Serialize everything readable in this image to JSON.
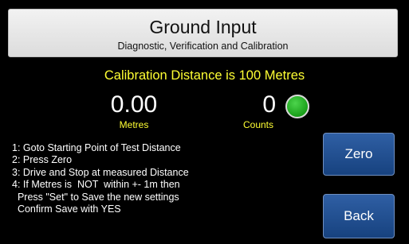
{
  "header": {
    "title": "Ground Input",
    "subtitle": "Diagnostic, Verification and Calibration"
  },
  "calibration": {
    "banner": "Calibration Distance is 100 Metres"
  },
  "readouts": {
    "distance_value": "0.00",
    "distance_unit": "Metres",
    "counts_value": "0",
    "counts_unit": "Counts",
    "status_color": "#1aa01a"
  },
  "instructions": [
    "1: Goto Starting Point of Test Distance",
    "2: Press Zero",
    "3: Drive and Stop at measured Distance",
    "4: If Metres is  NOT  within +- 1m then",
    "  Press \"Set\" to Save the new settings",
    "  Confirm Save with YES"
  ],
  "buttons": {
    "zero_label": "Zero",
    "back_label": "Back"
  },
  "colors": {
    "background": "#000000",
    "accent_text": "#ffff33",
    "button_blue": "#1f4f91",
    "header_panel": "#e6e6e6"
  }
}
